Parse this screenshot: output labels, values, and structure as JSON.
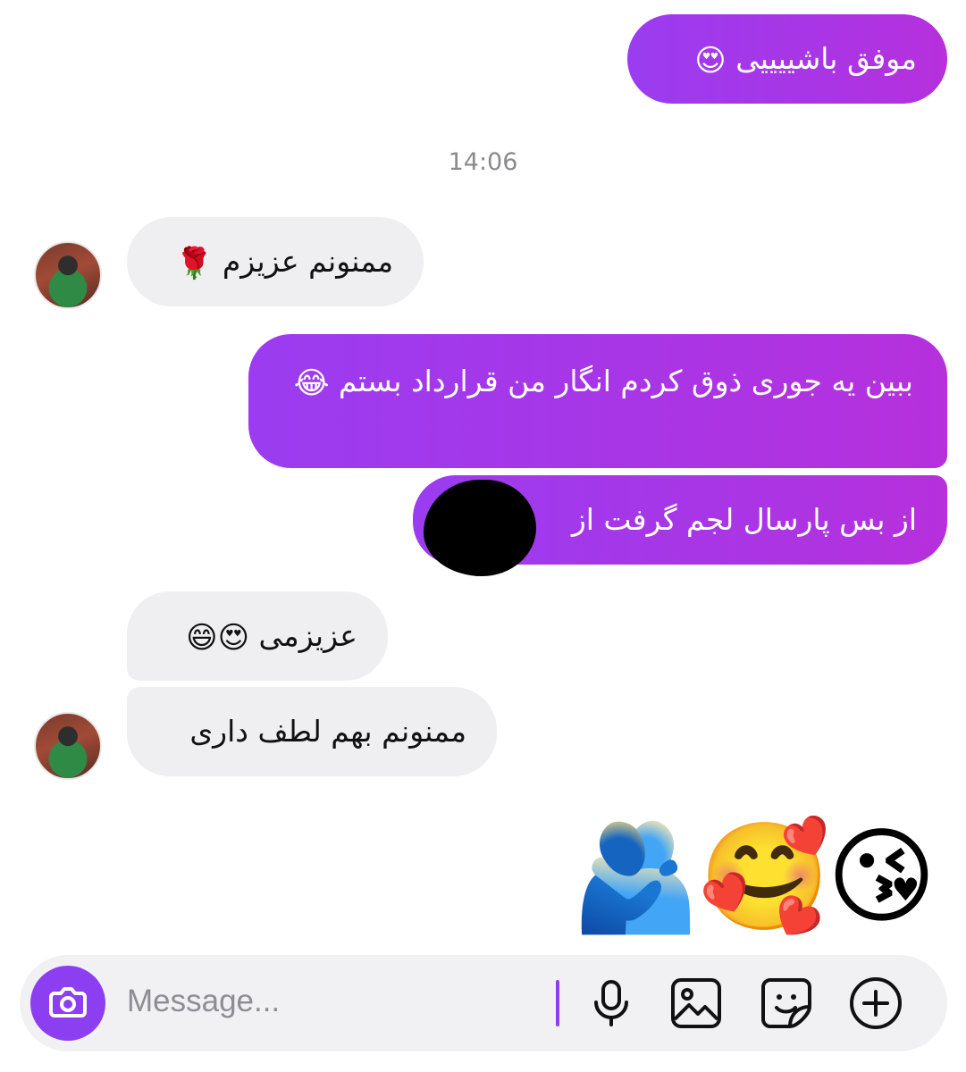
{
  "messages": [
    {
      "id": 1,
      "direction": "outgoing",
      "text": "موفق باشییییی",
      "emoji": "😍"
    },
    {
      "id": 2,
      "direction": "incoming",
      "text": "ممنونم عزیزم",
      "emoji": "🌹"
    },
    {
      "id": 3,
      "direction": "outgoing",
      "text": "ببین یه جوری ذوق کردم انگار من قرارداد بستم",
      "emoji": "😂"
    },
    {
      "id": 4,
      "direction": "outgoing",
      "text": "از بس پارسال لجم گرفت از"
    },
    {
      "id": 5,
      "direction": "incoming",
      "text": "عزیزمی",
      "emoji": "😍😄"
    },
    {
      "id": 6,
      "direction": "incoming",
      "text": "ممنونم بهم لطف داری"
    }
  ],
  "timestamp": "14:06",
  "reaction_emojis": [
    "🫂",
    "🥰",
    "😘"
  ],
  "composer": {
    "placeholder": "Message..."
  },
  "icons": {
    "camera": "camera-icon",
    "mic": "microphone-icon",
    "gallery": "image-icon",
    "sticker": "sticker-icon",
    "add": "plus-circle-icon"
  },
  "colors": {
    "outgoing_bubble": "#a836e6",
    "incoming_bubble": "#efeff2",
    "accent": "#8c3ff0"
  }
}
